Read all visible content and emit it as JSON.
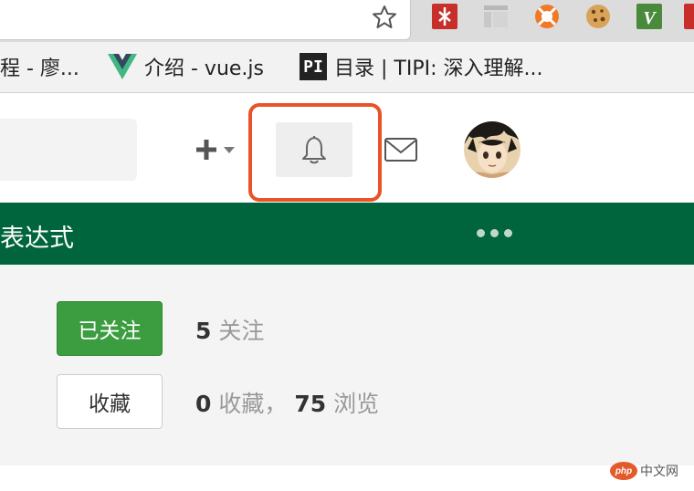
{
  "browser": {
    "bookmarks": [
      {
        "label": "程 - 廖..."
      },
      {
        "label": "介绍 - vue.js"
      },
      {
        "label": "目录 | TIPI: 深入理解..."
      }
    ],
    "pi_icon_text": "PI",
    "extensions": [
      "red-extension-icon",
      "gray-layout-extension-icon",
      "orange-lifebuoy-extension-icon",
      "cookie-extension-icon",
      "green-v-extension-icon"
    ]
  },
  "header": {
    "icons": [
      "plus-icon",
      "bell-icon",
      "mail-icon"
    ]
  },
  "greenbar": {
    "title": "表达式",
    "color": "#00643c"
  },
  "actions": {
    "follow_label": "已关注",
    "collect_label": "收藏"
  },
  "stats": {
    "follow_count": "5",
    "follow_label": "关注",
    "collect_count": "0",
    "collect_label": "收藏，",
    "view_count": "75",
    "view_label": "浏览"
  },
  "watermark": {
    "badge": "php",
    "text": "中文网"
  },
  "colors": {
    "highlight": "#e8532a",
    "follow_button": "#3c9d40"
  }
}
